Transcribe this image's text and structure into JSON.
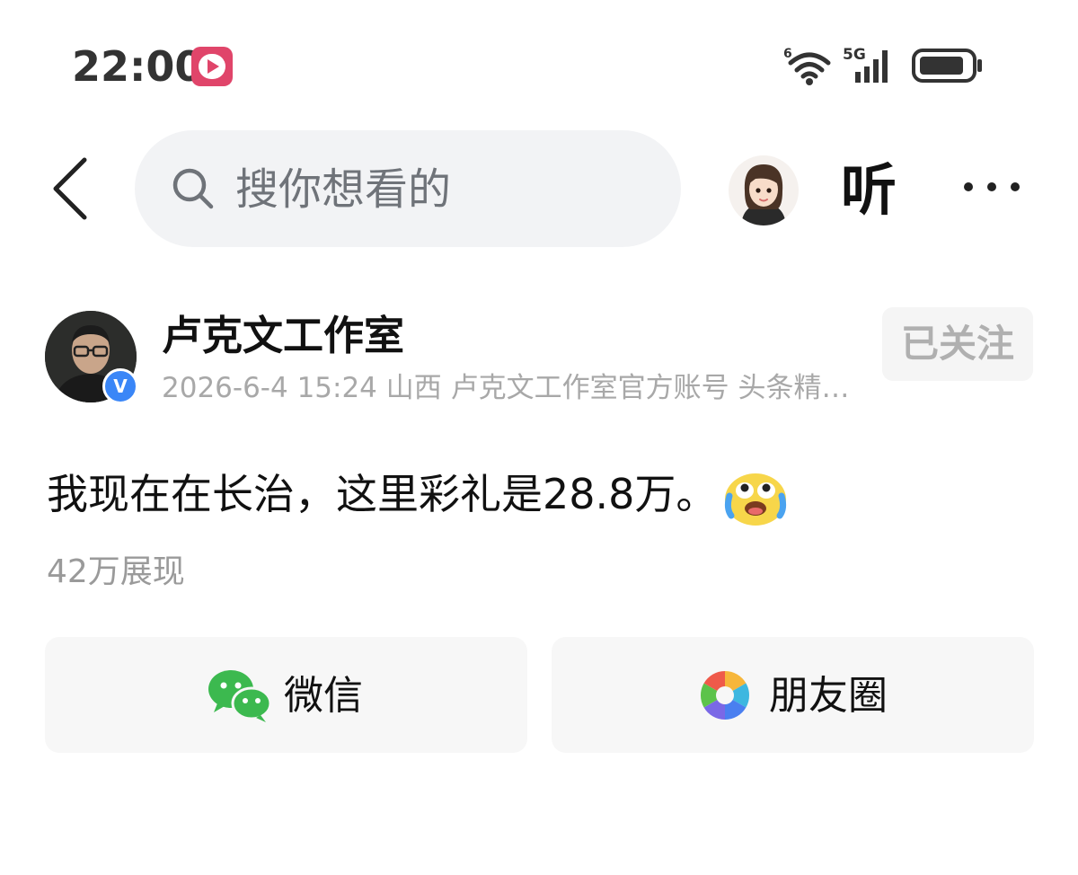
{
  "status_bar": {
    "time": "22:00",
    "wifi_icon": "wifi-6-icon",
    "network_label": "5G",
    "battery_icon": "battery-icon"
  },
  "nav": {
    "back_icon": "chevron-left-icon",
    "search_placeholder": "搜你想看的",
    "listen_label": "听",
    "more_icon": "ellipsis-icon"
  },
  "author": {
    "name": "卢克文工作室",
    "verified_label": "V",
    "meta": "2026-6-4 15:24 山西 卢克文工作室官方账号 头条精…",
    "follow_label": "已关注"
  },
  "post": {
    "text": "我现在在长治，这里彩礼是28.8万。",
    "emoji": "crying-laughing-emoji",
    "views": "42万展现"
  },
  "share": {
    "wechat_label": "微信",
    "moments_label": "朋友圈"
  },
  "colors": {
    "search_bg": "#f2f3f5",
    "card_bg": "#f7f7f7",
    "verified_blue": "#3a86f7",
    "wechat_green": "#3cb94f",
    "app_icon_red": "#e0456a"
  }
}
